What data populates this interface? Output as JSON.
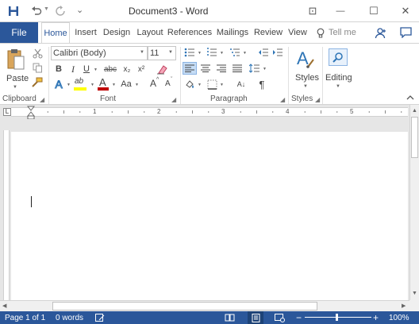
{
  "title_bar": {
    "title": "Document3 - Word",
    "customize_glyph": "⌄",
    "ribbon_display_glyph": "⊡",
    "minimize_glyph": "—",
    "maximize_glyph": "☐",
    "close_glyph": "✕"
  },
  "tabs": {
    "file": "File",
    "items": [
      "Home",
      "Insert",
      "Design",
      "Layout",
      "References",
      "Mailings",
      "Review",
      "View"
    ],
    "tell_me": "Tell me"
  },
  "ribbon": {
    "clipboard": {
      "paste": "Paste",
      "label": "Clipboard"
    },
    "font": {
      "font_name": "Calibri (Body)",
      "font_size": "11",
      "bold": "B",
      "italic": "I",
      "underline": "U",
      "strikethrough": "abc",
      "subscript": "x₂",
      "superscript": "x²",
      "text_effects": "A",
      "highlight": "ab",
      "font_color": "A",
      "change_case": "Aa",
      "grow": "A",
      "shrink": "A",
      "label": "Font"
    },
    "paragraph": {
      "sort": "A↓",
      "pilcrow": "¶",
      "label": "Paragraph"
    },
    "styles": {
      "label": "Styles",
      "group_label": "Styles"
    },
    "editing": {
      "label": "Editing"
    }
  },
  "ruler": {
    "numbers": [
      "1",
      "2",
      "3",
      "4",
      "5"
    ]
  },
  "status": {
    "page": "Page 1 of 1",
    "words": "0 words",
    "zoom": "100%"
  },
  "colors": {
    "accent": "#2b579a",
    "font_color_bar": "#c00000",
    "highlight_bar": "#ffff00"
  },
  "icons": [
    "save-icon",
    "undo-icon",
    "redo-icon",
    "person-icon",
    "comment-icon",
    "paste-icon",
    "cut-icon",
    "copy-icon",
    "format-painter-icon",
    "clear-format-icon",
    "bullets-icon",
    "numbering-icon",
    "multilevel-icon",
    "decrease-indent-icon",
    "increase-indent-icon",
    "align-left-icon",
    "center-icon",
    "align-right-icon",
    "justify-icon",
    "line-spacing-icon",
    "shading-icon",
    "borders-icon",
    "styles-icon",
    "find-icon",
    "collapse-ribbon-icon",
    "read-mode-icon",
    "print-layout-icon",
    "web-layout-icon"
  ]
}
